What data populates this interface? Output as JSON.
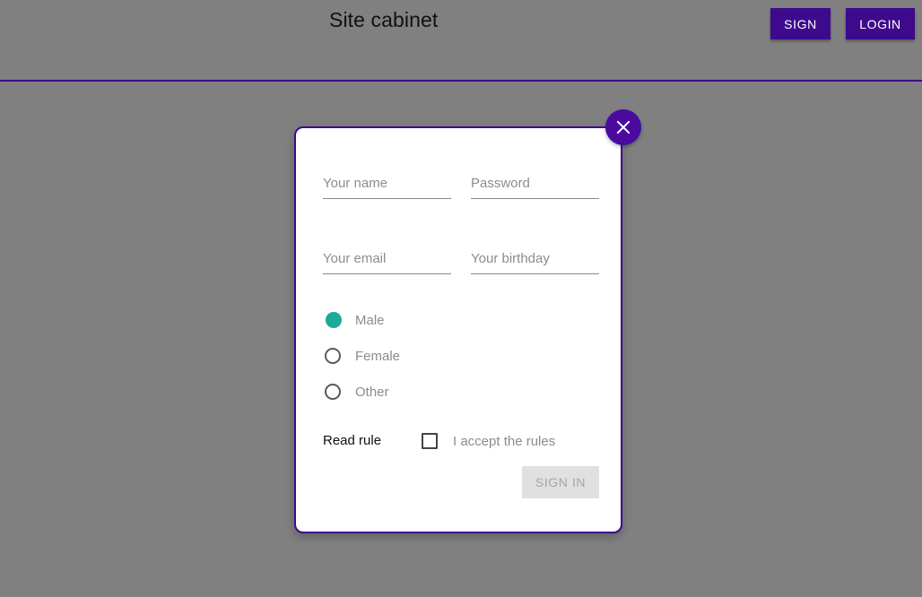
{
  "header": {
    "title": "Site cabinet",
    "sign_label": "SIGN",
    "login_label": "LOGIN"
  },
  "modal": {
    "close_icon": "close-icon",
    "fields": {
      "name_placeholder": "Your name",
      "password_placeholder": "Password",
      "email_placeholder": "Your email",
      "birthday_placeholder": "Your birthday"
    },
    "gender": {
      "options": [
        "Male",
        "Female",
        "Other"
      ],
      "selected": "Male"
    },
    "read_rule": "Read rule",
    "accept_label": "I accept the rules",
    "accept_checked": false,
    "submit_label": "SIGN IN"
  },
  "colors": {
    "accent": "#3d0a8c",
    "radio_selected": "#1aa99a",
    "overlay": "#808080"
  }
}
